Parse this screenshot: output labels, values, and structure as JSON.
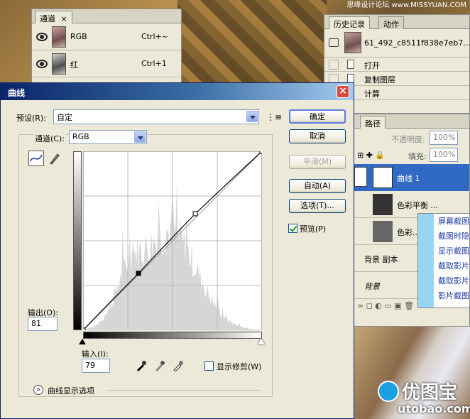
{
  "watermark_top": "思缘设计论坛 www.MISSYUAN.COM",
  "channels_panel": {
    "tab": "通道",
    "close": "×",
    "rows": [
      {
        "name": "RGB",
        "shortcut": "Ctrl+~"
      },
      {
        "name": "红",
        "shortcut": "Ctrl+1"
      }
    ]
  },
  "history_panel": {
    "tabs": [
      "历史记录",
      "动作"
    ],
    "snapshot": "61_492_c8511f838e7eb7...",
    "items": [
      "打开",
      "复制图层",
      "计算"
    ]
  },
  "layers_panel": {
    "tab_paths": "路径",
    "opacity_label": "不透明度:",
    "opacity_value": "100%",
    "fill_label": "填充:",
    "fill_value": "100%",
    "layers": [
      "曲线 1",
      "色彩平衡 ...",
      "色彩...",
      "背景 副本",
      "背景"
    ]
  },
  "context_menu": {
    "items": [
      "屏幕截图",
      "截图时隐",
      "显示截图",
      "截取影片",
      "截取影片",
      "影片截图"
    ]
  },
  "dialog": {
    "title": "曲线",
    "close": "×",
    "preset_label": "预设(R):",
    "preset_value": "自定",
    "channel_label": "通道(C):",
    "channel_value": "RGB",
    "output_label": "输出(O):",
    "output_value": "81",
    "input_label": "输入(I):",
    "input_value": "79",
    "show_clipping_label": "显示修剪(W)",
    "curve_options_label": "曲线显示选项",
    "buttons": {
      "ok": "确定",
      "cancel": "取消",
      "smooth": "平滑(M)",
      "auto": "自动(A)",
      "options": "选项(T)...",
      "preview": "预览(P)"
    }
  },
  "curve": {
    "points": [
      [
        0,
        0
      ],
      [
        79,
        81
      ],
      [
        160,
        166
      ],
      [
        255,
        255
      ]
    ],
    "selected_point": [
      79,
      81
    ]
  },
  "logo": {
    "name": "优图宝",
    "url": "utobao.com"
  },
  "colors": {
    "titlebar_start": "#0a246a",
    "titlebar_end": "#a6caf0",
    "layer_selected": "#316ac5",
    "context_menu_bar": "#9ad4f5"
  }
}
